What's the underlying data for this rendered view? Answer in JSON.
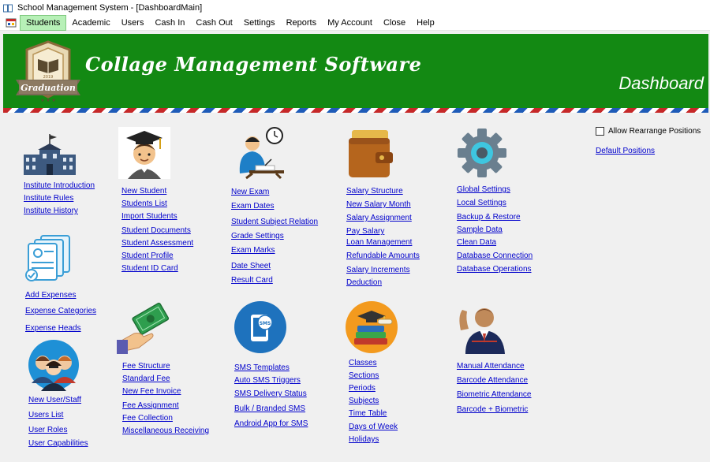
{
  "window": {
    "title": "School Management System - [DashboardMain]"
  },
  "menu": [
    "Students",
    "Academic",
    "Users",
    "Cash In",
    "Cash Out",
    "Settings",
    "Reports",
    "My Account",
    "Close",
    "Help"
  ],
  "banner": {
    "title": "Collage Management Software",
    "subtitle": "Dashboard",
    "logo_text": "Graduation",
    "logo_year": "2019"
  },
  "options": {
    "rearrange_label": "Allow Rearrange Positions",
    "rearrange_checked": false,
    "default_positions": "Default Positions"
  },
  "sections": {
    "institute": [
      "Institute Introduction",
      "Institute Rules",
      "Institute History"
    ],
    "expenses": [
      "Add Expenses",
      "Expense Categories",
      "Expense Heads"
    ],
    "users": [
      "New User/Staff",
      "Users List",
      "User Roles",
      "User Capabilities"
    ],
    "students": [
      "New Student",
      "Students List",
      "Import Students",
      "Student Documents",
      "Student Assessment",
      "Student Profile",
      "Student ID Card"
    ],
    "fees": [
      "Fee Structure",
      "Standard Fee",
      "New Fee Invoice",
      "Fee Assignment",
      "Fee Collection",
      "Miscellaneous Receiving"
    ],
    "exams": [
      "New Exam",
      "Exam Dates",
      "Student Subject Relation",
      "Grade Settings",
      "Exam Marks",
      "Date Sheet",
      "Result Card"
    ],
    "sms": [
      "SMS Templates",
      "Auto SMS Triggers",
      "SMS Delivery Status",
      "Bulk / Branded SMS",
      "Android App for SMS"
    ],
    "salary": [
      "Salary Structure",
      "New Salary Month",
      "Salary Assignment",
      "Pay Salary",
      "Loan Management",
      "Refundable Amounts",
      "Salary Increments",
      "Deduction"
    ],
    "academic": [
      "Classes",
      "Sections",
      "Periods",
      "Subjects",
      "Time Table",
      "Days of Week",
      "Holidays"
    ],
    "settings": [
      "Global Settings",
      "Local Settings",
      "Backup & Restore",
      "Sample Data",
      "Clean Data",
      "Database Connection",
      "Database Operations"
    ],
    "attendance": [
      "Manual Attendance",
      "Barcode Attendance",
      "Biometric Attendance",
      "Barcode + Biometric"
    ]
  },
  "colors": {
    "banner": "#138913",
    "link": "#0000cc",
    "active_menu": "#b7f0b7"
  }
}
